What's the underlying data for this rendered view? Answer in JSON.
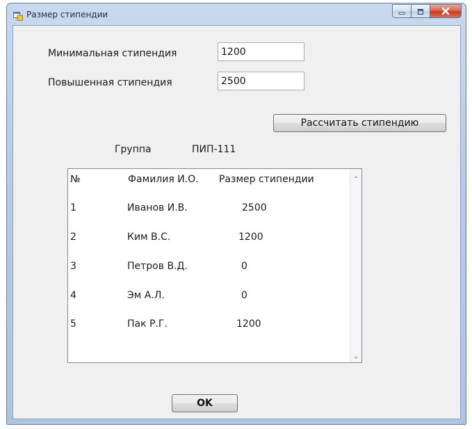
{
  "window": {
    "title": "Размер стипендии"
  },
  "form": {
    "min_label": "Минимальная стипендия",
    "min_value": "1200",
    "high_label": "Повышенная стипендия",
    "high_value": "2500",
    "calc_button": "Рассчитать стипендию",
    "group_label": "Группа",
    "group_value": "ПИП-111",
    "ok_button": "OK"
  },
  "list": {
    "headers": [
      "№",
      "Фамилия И.О.",
      "Размер стипендии"
    ],
    "rows": [
      [
        "1",
        "Иванов И.В.",
        "2500"
      ],
      [
        "2",
        "Ким В.С.",
        "1200"
      ],
      [
        "3",
        "Петров В.Д.",
        "0"
      ],
      [
        "4",
        "Эм А.Л.",
        "0"
      ],
      [
        "5",
        "Пак Р.Г.",
        "1200"
      ]
    ]
  },
  "icons": {
    "app": "form-app-icon",
    "minimize": "minimize-icon",
    "maximize": "maximize-icon",
    "close": "close-icon",
    "scroll_up": "scroll-up-arrow-icon",
    "scroll_down": "scroll-down-arrow-icon"
  },
  "colors": {
    "titlebar": "#b9cce6",
    "client_bg": "#f0f0f0",
    "close_button": "#c9452c"
  }
}
